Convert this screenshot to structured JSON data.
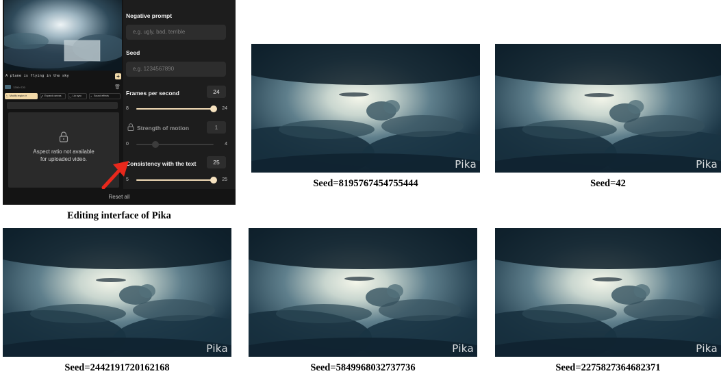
{
  "panel": {
    "prompt_text": "A plane is flying in the sky",
    "video_info": "1280×720",
    "chips": [
      "Modify region",
      "Expand canvas",
      "Lip sync",
      "Sound effects"
    ],
    "aspect_message_line1": "Aspect ratio not available",
    "aspect_message_line2": "for uploaded video.",
    "negative_prompt": {
      "label": "Negative prompt",
      "placeholder": "e.g. ugly, bad, terrible"
    },
    "seed": {
      "label": "Seed",
      "placeholder": "e.g. 1234567890"
    },
    "fps": {
      "label": "Frames per second",
      "value": "24",
      "min": "8",
      "max": "24",
      "level": 1.0
    },
    "motion": {
      "label": "Strength of motion",
      "value": "1",
      "min": "0",
      "max": "4",
      "level": 0.25
    },
    "consistency": {
      "label": "Consistency with the text",
      "value": "25",
      "min": "5",
      "max": "25",
      "level": 1.0
    },
    "reset_label": "Reset all"
  },
  "captions": {
    "panel": "Editing interface of Pika",
    "seeds": [
      "Seed=8195767454755444",
      "Seed=42",
      "Seed=2442191720162168",
      "Seed=5849968032737736",
      "Seed=2275827364682371"
    ]
  },
  "watermark": "Pika",
  "colors": {
    "accent": "#f3dcb6",
    "arrow": "#e8281c",
    "panel_bg": "#141414"
  }
}
